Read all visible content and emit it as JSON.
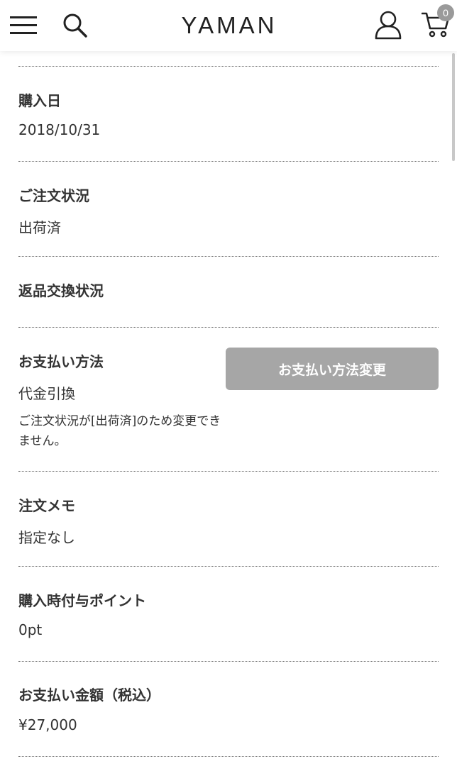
{
  "header": {
    "logo": "YAMAN",
    "menu_icon": "hamburger-menu-icon",
    "search_icon": "search-icon",
    "account_icon": "user-icon",
    "cart_icon": "cart-icon",
    "cart_count": "0"
  },
  "details": {
    "purchase_date": {
      "label": "購入日",
      "value": "2018/10/31"
    },
    "order_status": {
      "label": "ご注文状況",
      "value": "出荷済"
    },
    "return_status": {
      "label": "返品交換状況",
      "value": ""
    },
    "payment_method": {
      "label": "お支払い方法",
      "value": "代金引換",
      "note": "ご注文状況が[出荷済]のため変更できません。",
      "change_button": "お支払い方法変更"
    },
    "order_memo": {
      "label": "注文メモ",
      "value": "指定なし"
    },
    "points": {
      "label": "購入時付与ポイント",
      "value": "0pt"
    },
    "total": {
      "label": "お支払い金額（税込）",
      "value": "¥27,000"
    }
  },
  "colors": {
    "disabled_button": "#a6a6a6",
    "text": "#333333",
    "badge": "#9a9a9a"
  }
}
